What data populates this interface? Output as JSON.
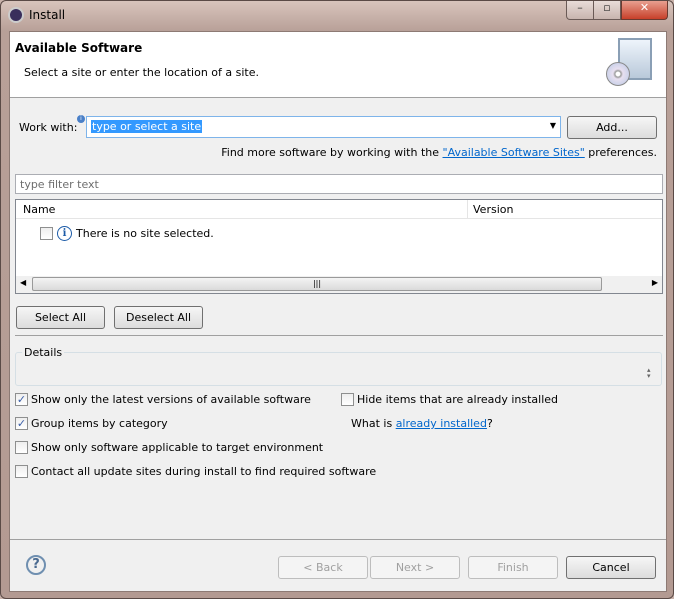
{
  "window": {
    "title": "Install",
    "icon": "eclipse-gear-icon"
  },
  "header": {
    "title": "Available Software",
    "subtitle": "Select a site or enter the location of a site.",
    "icon": "install-cd-monitor-icon"
  },
  "work_with": {
    "label": "Work with:",
    "placeholder": "type or select a site",
    "add_label": "Add...",
    "info_icon": "info-icon"
  },
  "more_software": {
    "prefix": "Find more software by working with the ",
    "link": "\"Available Software Sites\"",
    "suffix": " preferences."
  },
  "filter": {
    "placeholder": "type filter text"
  },
  "table": {
    "columns": [
      "Name",
      "Version"
    ],
    "rows": [
      {
        "checked": false,
        "icon": "info-icon",
        "name": "There is no site selected."
      }
    ]
  },
  "buttons": {
    "select_all": "Select All",
    "deselect_all": "Deselect All",
    "back": "< Back",
    "next": "Next >",
    "finish": "Finish",
    "cancel": "Cancel"
  },
  "details": {
    "label": "Details"
  },
  "options": {
    "latest": {
      "label": "Show only the latest versions of available software",
      "checked": true
    },
    "hide_installed": {
      "label": "Hide items that are already installed",
      "checked": false
    },
    "group": {
      "label": "Group items by category",
      "checked": true
    },
    "target_env": {
      "label": "Show only software applicable to target environment",
      "checked": false
    },
    "contact_all": {
      "label": "Contact all update sites during install to find required software",
      "checked": false
    }
  },
  "what_is": {
    "prefix": "What is ",
    "link": "already installed",
    "suffix": "?"
  },
  "colors": {
    "accent": "#3399ff",
    "link": "#0066cc"
  }
}
